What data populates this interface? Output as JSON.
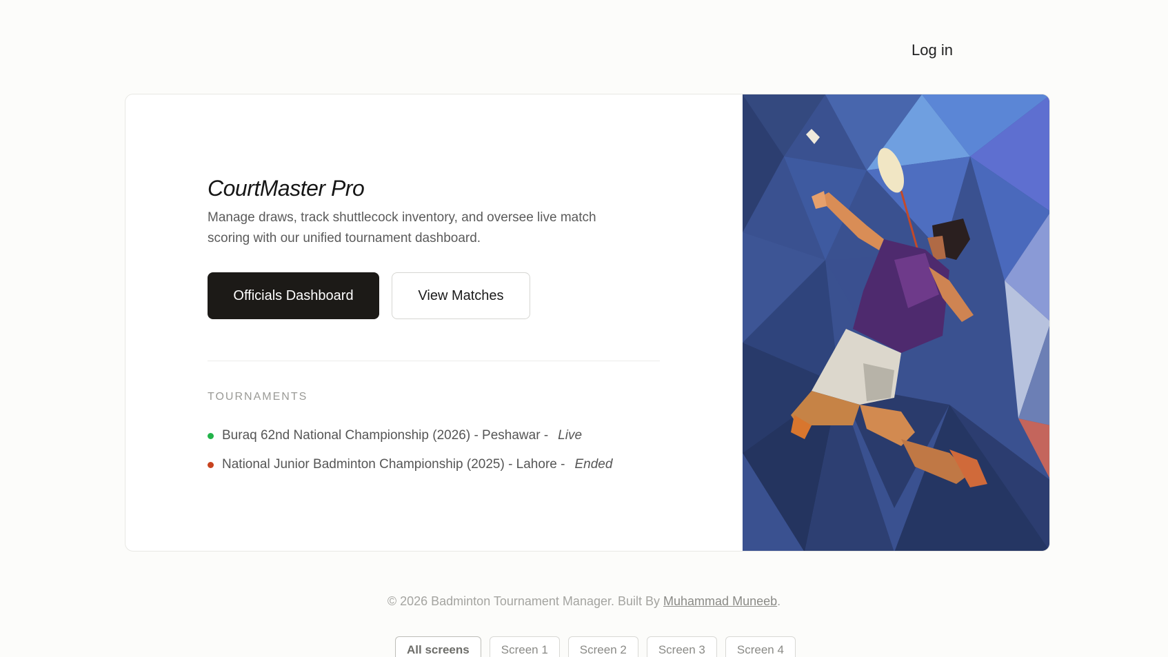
{
  "header": {
    "login_label": "Log in"
  },
  "hero": {
    "title": "CourtMaster Pro",
    "subtitle": "Manage draws, track shuttlecock inventory, and oversee live match scoring with our unified tournament dashboard.",
    "primary_button": "Officials Dashboard",
    "secondary_button": "View Matches"
  },
  "tournaments": {
    "label": "TOURNAMENTS",
    "items": [
      {
        "name": "Buraq 62nd National Championship (2026) - Peshawar -",
        "status": "Live",
        "status_color": "#22b34a"
      },
      {
        "name": "National Junior Badminton Championship (2025) - Lahore -",
        "status": "Ended",
        "status_color": "#c8431f"
      }
    ]
  },
  "footer": {
    "text": "© 2026 Badminton Tournament Manager. Built By",
    "author": "Muhammad Muneeb",
    "period": "."
  },
  "screens": [
    "All screens",
    "Screen 1",
    "Screen 2",
    "Screen 3",
    "Screen 4"
  ],
  "colors": {
    "primary_button_bg": "#1c1a17",
    "live": "#22b34a",
    "ended": "#c8431f",
    "image_bg": "#3a5190"
  },
  "image": {
    "description_icon": "badminton-player-illustration"
  }
}
